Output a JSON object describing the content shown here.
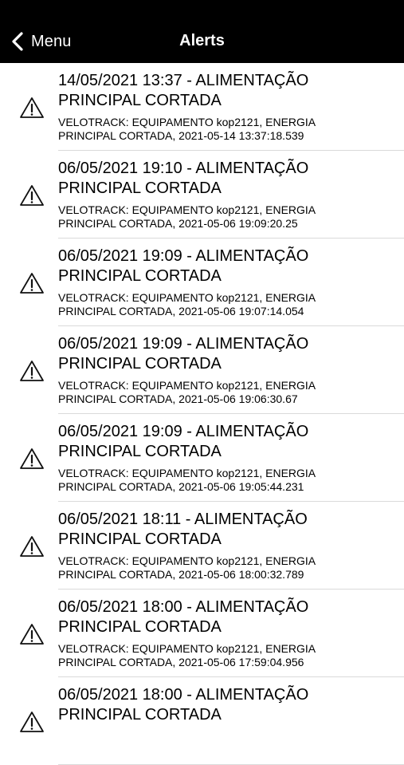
{
  "navbar": {
    "back_label": "Menu",
    "title": "Alerts",
    "back_icon": "chevron-left-icon",
    "background": "#000000",
    "text_color": "#ffffff"
  },
  "alert_icon": "warning-triangle-icon",
  "alerts": [
    {
      "title_line1": "14/05/2021 13:37 - ALIMENTAÇÃO",
      "title_line2": "PRINCIPAL CORTADA",
      "desc_line1": "VELOTRACK: EQUIPAMENTO kop2121, ENERGIA",
      "desc_line2": "PRINCIPAL CORTADA, 2021-05-14 13:37:18.539"
    },
    {
      "title_line1": "06/05/2021 19:10 - ALIMENTAÇÃO",
      "title_line2": "PRINCIPAL CORTADA",
      "desc_line1": "VELOTRACK: EQUIPAMENTO kop2121, ENERGIA",
      "desc_line2": "PRINCIPAL CORTADA, 2021-05-06 19:09:20.25"
    },
    {
      "title_line1": "06/05/2021 19:09 - ALIMENTAÇÃO",
      "title_line2": "PRINCIPAL CORTADA",
      "desc_line1": "VELOTRACK: EQUIPAMENTO kop2121, ENERGIA",
      "desc_line2": "PRINCIPAL CORTADA, 2021-05-06 19:07:14.054"
    },
    {
      "title_line1": "06/05/2021 19:09 - ALIMENTAÇÃO",
      "title_line2": "PRINCIPAL CORTADA",
      "desc_line1": "VELOTRACK: EQUIPAMENTO kop2121, ENERGIA",
      "desc_line2": "PRINCIPAL CORTADA, 2021-05-06 19:06:30.67"
    },
    {
      "title_line1": "06/05/2021 19:09 - ALIMENTAÇÃO",
      "title_line2": "PRINCIPAL CORTADA",
      "desc_line1": "VELOTRACK: EQUIPAMENTO kop2121, ENERGIA",
      "desc_line2": "PRINCIPAL CORTADA, 2021-05-06 19:05:44.231"
    },
    {
      "title_line1": "06/05/2021 18:11 - ALIMENTAÇÃO",
      "title_line2": "PRINCIPAL CORTADA",
      "desc_line1": "VELOTRACK: EQUIPAMENTO kop2121, ENERGIA",
      "desc_line2": "PRINCIPAL CORTADA, 2021-05-06 18:00:32.789"
    },
    {
      "title_line1": "06/05/2021 18:00 - ALIMENTAÇÃO",
      "title_line2": "PRINCIPAL CORTADA",
      "desc_line1": "VELOTRACK: EQUIPAMENTO kop2121, ENERGIA",
      "desc_line2": "PRINCIPAL CORTADA, 2021-05-06 17:59:04.956"
    },
    {
      "title_line1": "06/05/2021 18:00 - ALIMENTAÇÃO",
      "title_line2": "PRINCIPAL CORTADA",
      "desc_line1": "",
      "desc_line2": ""
    }
  ]
}
